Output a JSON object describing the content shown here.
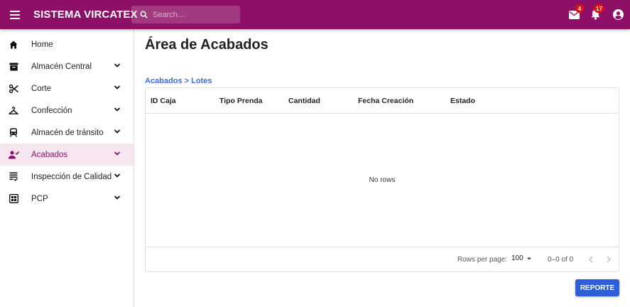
{
  "appbar": {
    "title": "SISTEMA VIRCATEX",
    "search_placeholder": "Search…",
    "mail_count": "4",
    "notification_count": "17"
  },
  "sidebar": {
    "items": [
      {
        "label": "Home",
        "icon": "home-icon",
        "expandable": false
      },
      {
        "label": "Almacén Central",
        "icon": "archive-icon",
        "expandable": true
      },
      {
        "label": "Corte",
        "icon": "scissors-icon",
        "expandable": true
      },
      {
        "label": "Confección",
        "icon": "hanger-icon",
        "expandable": true
      },
      {
        "label": "Almacén de tránsito",
        "icon": "train-icon",
        "expandable": true
      },
      {
        "label": "Acabados",
        "icon": "person-check-icon",
        "expandable": true,
        "active": true
      },
      {
        "label": "Inspección de Calidad",
        "icon": "checklist-icon",
        "expandable": true
      },
      {
        "label": "PCP",
        "icon": "calendar-icon",
        "expandable": true
      }
    ]
  },
  "main": {
    "title": "Área de Acabados",
    "breadcrumb": {
      "parent": "Acabados",
      "separator": " > ",
      "current": "Lotes"
    },
    "grid": {
      "columns": [
        "ID Caja",
        "Tipo Prenda",
        "Cantidad",
        "Fecha Creación",
        "Estado"
      ],
      "rows": [],
      "empty_text": "No rows",
      "footer": {
        "rows_per_page_label": "Rows per page:",
        "rows_per_page_value": "100",
        "range": "0–0 of 0"
      }
    },
    "report_button": "REPORTE"
  },
  "colors": {
    "primary": "#8e0f66",
    "accent": "#2f5fd6",
    "link": "#3d6ee0",
    "badge": "#e01010"
  }
}
